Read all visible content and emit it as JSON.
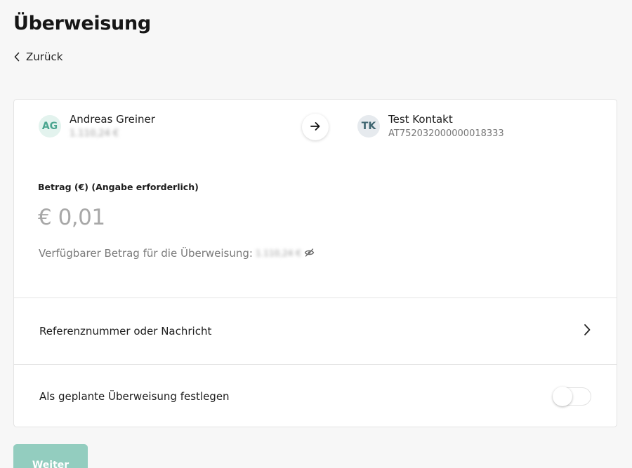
{
  "header": {
    "title": "Überweisung",
    "back_label": "Zurück"
  },
  "sender": {
    "initials": "AG",
    "name": "Andreas Greiner",
    "balance_blurred": "1.110,24 €"
  },
  "recipient": {
    "initials": "TK",
    "name": "Test Kontakt",
    "iban": "AT752032000000018333"
  },
  "amount": {
    "label": "Betrag (€) (Angabe erforderlich)",
    "value": "€ 0,01",
    "available_label": "Verfügbarer Betrag für die Überweisung:",
    "available_value_blurred": "1.110,24 €"
  },
  "reference": {
    "label": "Referenznummer oder Nachricht"
  },
  "schedule": {
    "label": "Als geplante Überweisung festlegen",
    "enabled": false
  },
  "footer": {
    "next_label": "Weiter"
  },
  "colors": {
    "accent": "#93cdbf",
    "avatar_ag_bg": "#e3f3ee",
    "avatar_tk_bg": "#e6eaee"
  },
  "icons": {
    "back": "chevron-left-icon",
    "transfer": "arrow-right-icon",
    "visibility": "eye-off-icon",
    "reference": "chevron-right-icon"
  }
}
